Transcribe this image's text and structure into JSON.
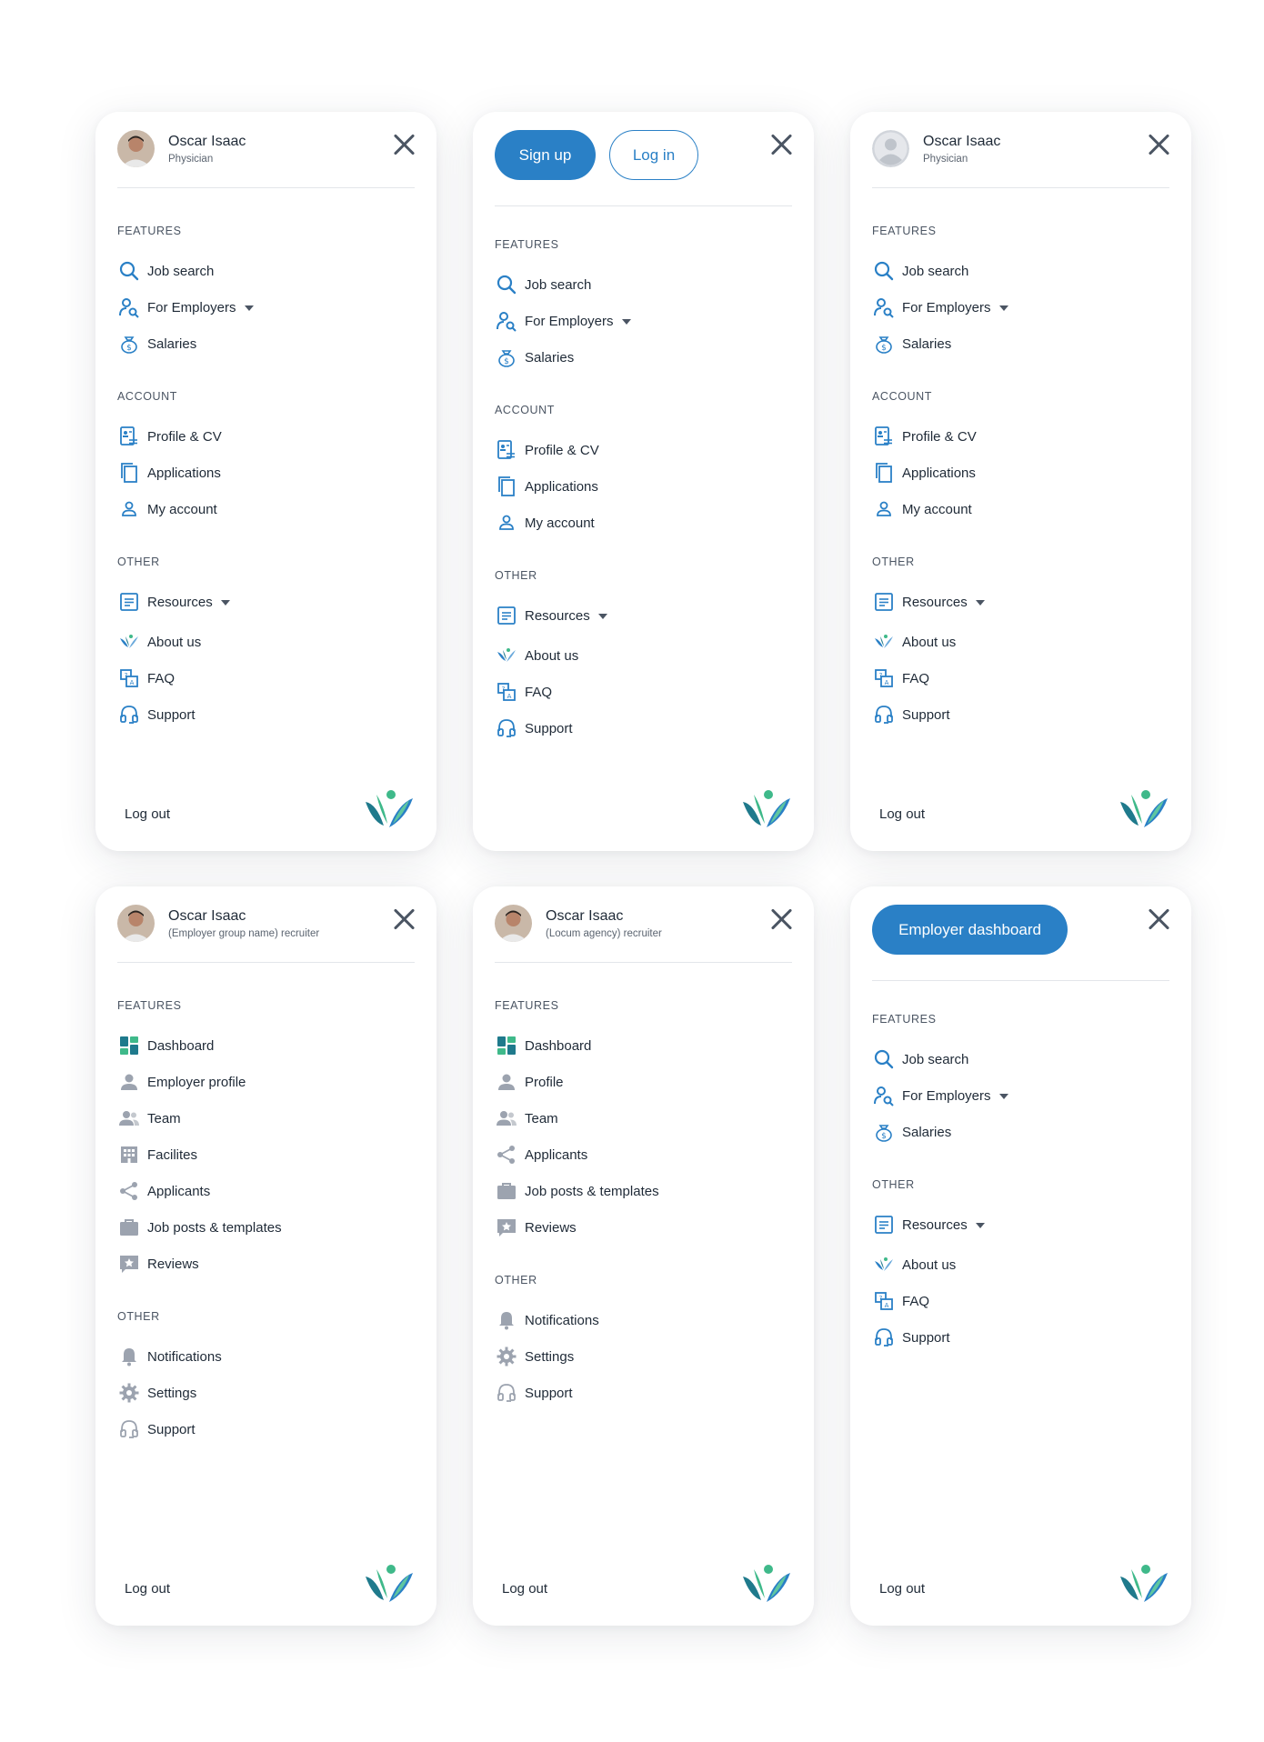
{
  "user": {
    "name": "Oscar Isaac"
  },
  "panels": {
    "p1": {
      "role": "Physician",
      "sections": {
        "features": "FEATURES",
        "account": "ACCOUNT",
        "other": "OTHER"
      },
      "features": [
        "Job search",
        "For Employers",
        "Salaries"
      ],
      "account": [
        "Profile & CV",
        "Applications",
        "My account"
      ],
      "other": [
        "Resources",
        "About us",
        "FAQ",
        "Support"
      ],
      "logout": "Log out"
    },
    "p2": {
      "signup": "Sign up",
      "login": "Log in",
      "sections": {
        "features": "FEATURES",
        "account": "ACCOUNT",
        "other": "OTHER"
      },
      "features": [
        "Job search",
        "For Employers",
        "Salaries"
      ],
      "account": [
        "Profile & CV",
        "Applications",
        "My account"
      ],
      "other": [
        "Resources",
        "About us",
        "FAQ",
        "Support"
      ]
    },
    "p3": {
      "role": "Physician",
      "sections": {
        "features": "FEATURES",
        "account": "ACCOUNT",
        "other": "OTHER"
      },
      "features": [
        "Job search",
        "For Employers",
        "Salaries"
      ],
      "account": [
        "Profile & CV",
        "Applications",
        "My account"
      ],
      "other": [
        "Resources",
        "About us",
        "FAQ",
        "Support"
      ],
      "logout": "Log out"
    },
    "p4": {
      "role": "(Employer group name) recruiter",
      "sections": {
        "features": "FEATURES",
        "other": "OTHER"
      },
      "features": [
        "Dashboard",
        "Employer profile",
        "Team",
        "Facilites",
        "Applicants",
        "Job posts & templates",
        "Reviews"
      ],
      "other": [
        "Notifications",
        "Settings",
        "Support"
      ],
      "logout": "Log out"
    },
    "p5": {
      "role": "(Locum agency) recruiter",
      "sections": {
        "features": "FEATURES",
        "other": "OTHER"
      },
      "features": [
        "Dashboard",
        "Profile",
        "Team",
        "Applicants",
        "Job posts & templates",
        "Reviews"
      ],
      "other": [
        "Notifications",
        "Settings",
        "Support"
      ],
      "logout": "Log out"
    },
    "p6": {
      "dashboard_button": "Employer dashboard",
      "sections": {
        "features": "FEATURES",
        "other": "OTHER"
      },
      "features": [
        "Job search",
        "For Employers",
        "Salaries"
      ],
      "other": [
        "Resources",
        "About us",
        "FAQ",
        "Support"
      ],
      "logout": "Log out"
    }
  },
  "colors": {
    "accent": "#2a80c6",
    "icon_gray": "#9ca3af",
    "text": "#1f2a37",
    "logo_green": "#3fb98a",
    "logo_teal": "#1f7a8c"
  },
  "icons": [
    "search-icon",
    "user-search-icon",
    "money-bag-icon",
    "profile-cv-icon",
    "applications-icon",
    "user-icon",
    "resources-icon",
    "about-us-logo-icon",
    "faq-icon",
    "support-headset-icon",
    "dashboard-grid-icon",
    "person-icon",
    "team-icon",
    "building-icon",
    "share-icon",
    "briefcase-icon",
    "star-review-icon",
    "bell-icon",
    "gear-icon",
    "close-icon",
    "brand-logo"
  ]
}
